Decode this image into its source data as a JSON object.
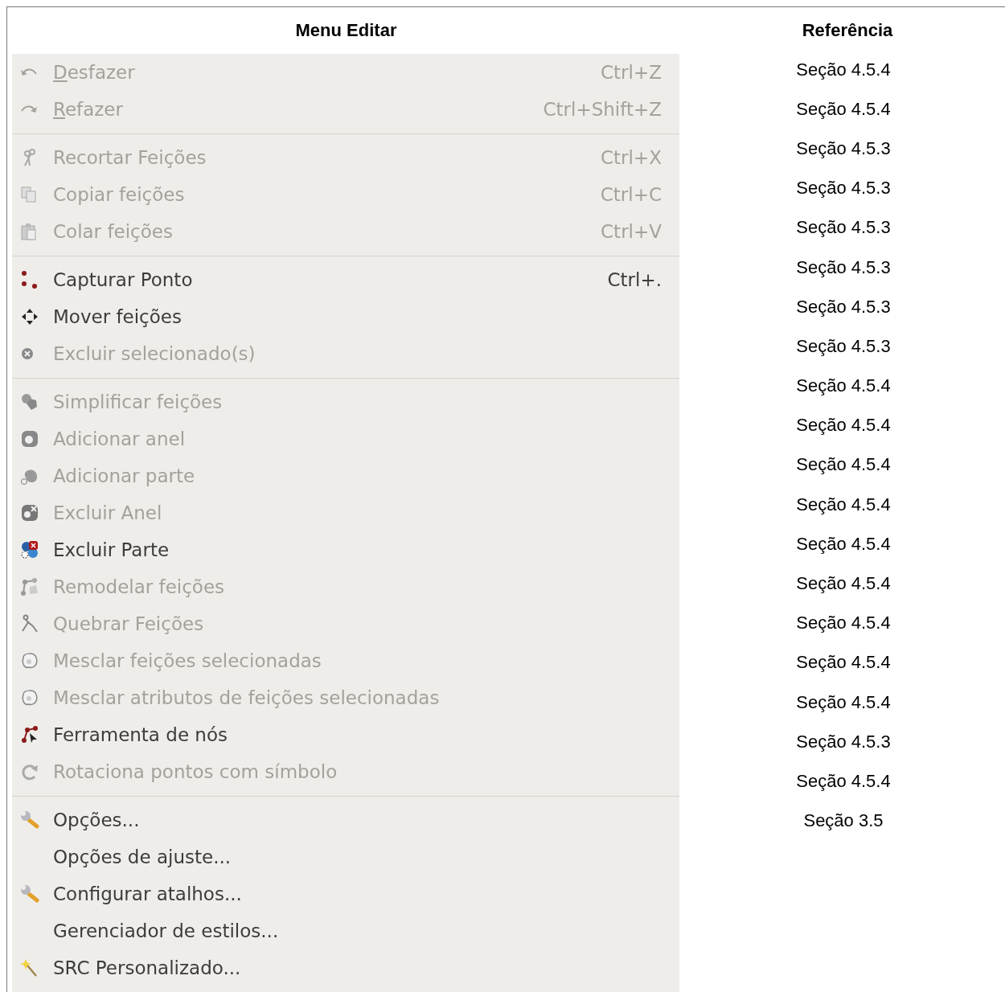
{
  "headers": [
    "Menu Editar",
    "Referência"
  ],
  "menu_groups": [
    [
      {
        "kind": "undo",
        "label": "Desfazer",
        "mnemonic": true,
        "shortcut": "Ctrl+Z",
        "disabled": true
      },
      {
        "kind": "redo",
        "label": "Refazer",
        "mnemonic": true,
        "shortcut": "Ctrl+Shift+Z",
        "disabled": true
      }
    ],
    [
      {
        "kind": "scissors",
        "label": "Recortar Feições",
        "mnemonic": false,
        "shortcut": "Ctrl+X",
        "disabled": true
      },
      {
        "kind": "copy",
        "label": "Copiar feições",
        "mnemonic": false,
        "shortcut": "Ctrl+C",
        "disabled": true
      },
      {
        "kind": "paste",
        "label": "Colar feições",
        "mnemonic": false,
        "shortcut": "Ctrl+V",
        "disabled": true
      }
    ],
    [
      {
        "kind": "points",
        "label": "Capturar Ponto",
        "mnemonic": false,
        "shortcut": "Ctrl+.",
        "disabled": false
      },
      {
        "kind": "move",
        "label": "Mover feições",
        "mnemonic": false,
        "disabled": false
      },
      {
        "kind": "delete",
        "label": "Excluir selecionado(s)",
        "mnemonic": false,
        "disabled": true
      }
    ],
    [
      {
        "kind": "simplify",
        "label": "Simplificar feições",
        "mnemonic": false,
        "disabled": true
      },
      {
        "kind": "ring",
        "label": "Adicionar anel",
        "mnemonic": false,
        "disabled": true
      },
      {
        "kind": "part",
        "label": "Adicionar parte",
        "mnemonic": false,
        "disabled": true
      },
      {
        "kind": "ringdel",
        "label": "Excluir Anel",
        "mnemonic": false,
        "disabled": true
      },
      {
        "kind": "partdel",
        "label": "Excluir Parte",
        "mnemonic": false,
        "disabled": false
      },
      {
        "kind": "reshape",
        "label": "Remodelar feições",
        "mnemonic": false,
        "disabled": true
      },
      {
        "kind": "split",
        "label": "Quebrar Feições",
        "mnemonic": false,
        "disabled": true
      },
      {
        "kind": "merge",
        "label": "Mesclar feições selecionadas",
        "mnemonic": false,
        "disabled": true
      },
      {
        "kind": "merge",
        "label": "Mesclar atributos de feições selecionadas",
        "mnemonic": false,
        "disabled": true
      },
      {
        "kind": "nodes",
        "label": "Ferramenta de nós",
        "mnemonic": false,
        "disabled": false
      },
      {
        "kind": "rotate",
        "label": "Rotaciona pontos com símbolo",
        "mnemonic": false,
        "disabled": true
      }
    ],
    [
      {
        "kind": "wrench",
        "label": "Opções...",
        "mnemonic": false,
        "disabled": false
      },
      {
        "kind": "none",
        "label": "Opções de ajuste...",
        "mnemonic": false,
        "disabled": false
      },
      {
        "kind": "wrench",
        "label": "Configurar atalhos...",
        "mnemonic": false,
        "disabled": false
      },
      {
        "kind": "none",
        "label": "Gerenciador de estilos...",
        "mnemonic": false,
        "disabled": false
      },
      {
        "kind": "wand",
        "label": "SRC Personalizado...",
        "mnemonic": false,
        "disabled": false
      }
    ]
  ],
  "references": [
    "Seção 4.5.4",
    "Seção 4.5.4",
    "Seção 4.5.3",
    "Seção 4.5.3",
    "Seção 4.5.3",
    "Seção 4.5.3",
    "Seção 4.5.3",
    "Seção 4.5.3",
    "Seção 4.5.4",
    "Seção 4.5.4",
    "Seção 4.5.4",
    "Seção 4.5.4",
    "Seção 4.5.4",
    "Seção 4.5.4",
    "Seção 4.5.4",
    "Seção 4.5.4",
    "Seção 4.5.4",
    "Seção 4.5.3",
    "Seção 4.5.4",
    "Seção 3.5"
  ]
}
